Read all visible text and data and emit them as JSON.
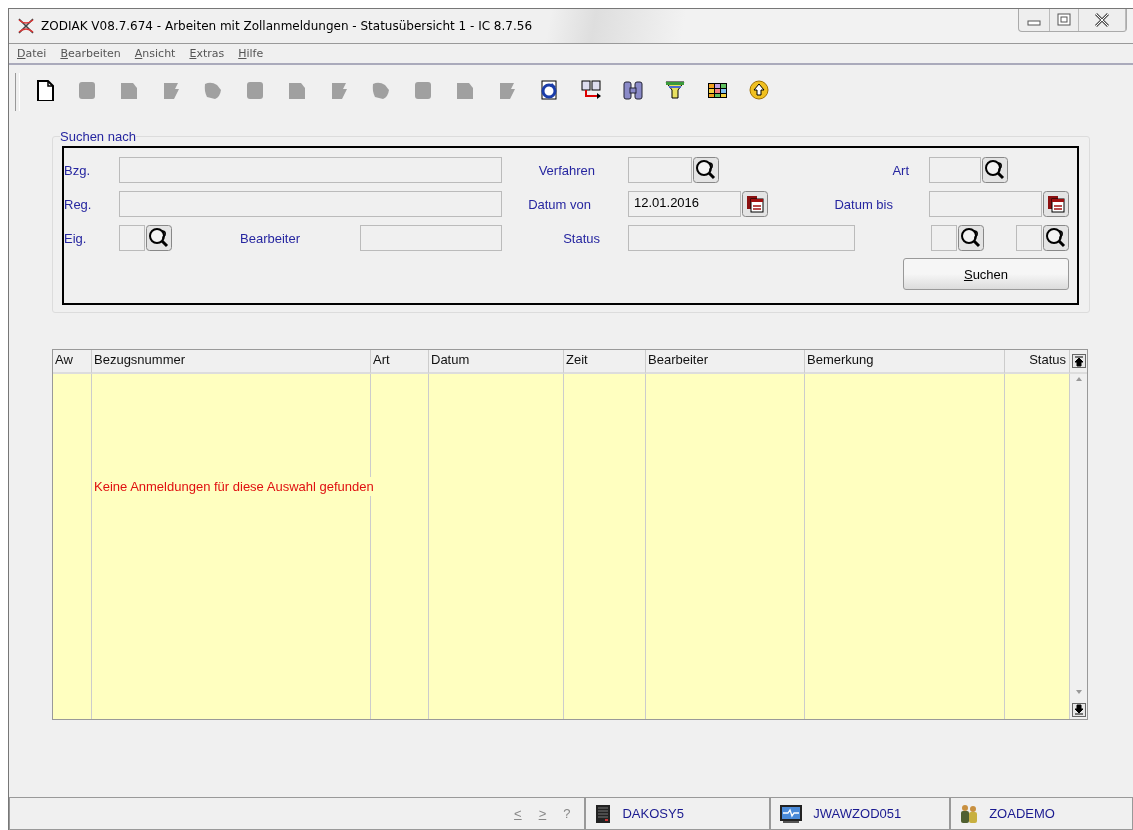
{
  "window": {
    "title": "ZODIAK V08.7.674 - Arbeiten mit Zollanmeldungen - Statusübersicht 1 - IC 8.7.56"
  },
  "menu": [
    "Datei",
    "Bearbeiten",
    "Ansicht",
    "Extras",
    "Hilfe"
  ],
  "toolbar": [
    {
      "kind": "new-document",
      "disabled": false
    },
    {
      "kind": "tool",
      "disabled": true
    },
    {
      "kind": "tool",
      "disabled": true
    },
    {
      "kind": "tool",
      "disabled": true
    },
    {
      "kind": "tool",
      "disabled": true
    },
    {
      "kind": "tool",
      "disabled": true
    },
    {
      "kind": "tool",
      "disabled": true
    },
    {
      "kind": "tool",
      "disabled": true
    },
    {
      "kind": "tool",
      "disabled": true
    },
    {
      "kind": "tool",
      "disabled": true
    },
    {
      "kind": "tool",
      "disabled": true
    },
    {
      "kind": "tool",
      "disabled": true
    },
    {
      "kind": "refresh",
      "disabled": false
    },
    {
      "kind": "transfer",
      "disabled": false
    },
    {
      "kind": "binoculars",
      "disabled": false
    },
    {
      "kind": "filter",
      "disabled": false
    },
    {
      "kind": "grid",
      "disabled": false
    },
    {
      "kind": "upload",
      "disabled": false
    }
  ],
  "search": {
    "title": "Suchen nach",
    "bzg": {
      "label": "Bzg."
    },
    "reg": {
      "label": "Reg."
    },
    "eig": {
      "label": "Eig."
    },
    "bearbeiter": {
      "label": "Bearbeiter"
    },
    "verfahren": {
      "label": "Verfahren"
    },
    "datum_von": {
      "label": "Datum von",
      "value": "12.01.2016"
    },
    "status": {
      "label": "Status"
    },
    "art": {
      "label": "Art"
    },
    "datum_bis": {
      "label": "Datum bis"
    },
    "button": "Suchen"
  },
  "table": {
    "columns": [
      "Aw",
      "Bezugsnummer",
      "Art",
      "Datum",
      "Zeit",
      "Bearbeiter",
      "Bemerkung",
      "Status"
    ],
    "message": "Keine Anmeldungen für diese Auswahl gefunden"
  },
  "status_bar": {
    "nav": [
      "<",
      ">",
      "?"
    ],
    "panels": [
      {
        "kind": "server",
        "label": "DAKOSY5"
      },
      {
        "kind": "monitor",
        "label": "JWAWZOD051"
      },
      {
        "kind": "users",
        "label": "ZOADEMO"
      }
    ]
  }
}
